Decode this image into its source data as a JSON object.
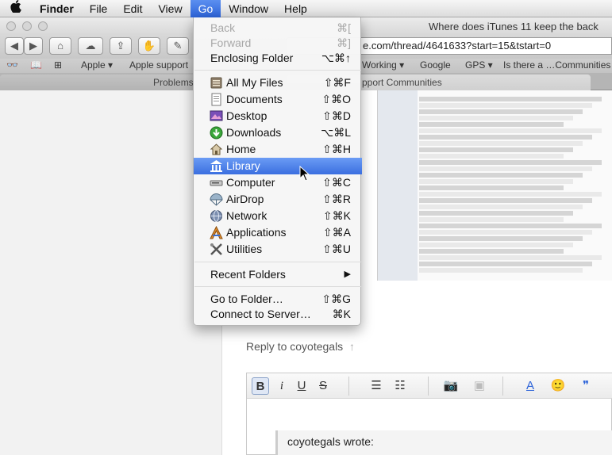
{
  "menubar": {
    "apple_icon": "apple-logo-icon",
    "items": [
      "Finder",
      "File",
      "Edit",
      "View",
      "Go",
      "Window",
      "Help"
    ]
  },
  "window": {
    "title": "Where does iTunes 11 keep the back"
  },
  "toolbar": {
    "url": "e.com/thread/4641633?start=15&tstart=0"
  },
  "bookmarks": [
    "Apple ▾",
    "Apple support",
    "Working ▾",
    "Google",
    "GPS ▾",
    "Is there a …Communities"
  ],
  "tabs": [
    "Problems",
    "pport Communities"
  ],
  "go_menu": {
    "items": [
      {
        "label": "Back",
        "shortcut": "⌘[",
        "disabled": true
      },
      {
        "label": "Forward",
        "shortcut": "⌘]",
        "disabled": true
      },
      {
        "label": "Enclosing Folder",
        "shortcut": "⌥⌘↑"
      },
      {
        "label": "All My Files",
        "shortcut": "⇧⌘F",
        "icon": "all-my-files-icon"
      },
      {
        "label": "Documents",
        "shortcut": "⇧⌘O",
        "icon": "documents-icon"
      },
      {
        "label": "Desktop",
        "shortcut": "⇧⌘D",
        "icon": "desktop-icon"
      },
      {
        "label": "Downloads",
        "shortcut": "⌥⌘L",
        "icon": "downloads-icon"
      },
      {
        "label": "Home",
        "shortcut": "⇧⌘H",
        "icon": "home-icon"
      },
      {
        "label": "Library",
        "shortcut": "",
        "icon": "library-icon",
        "highlighted": true
      },
      {
        "label": "Computer",
        "shortcut": "⇧⌘C",
        "icon": "computer-icon"
      },
      {
        "label": "AirDrop",
        "shortcut": "⇧⌘R",
        "icon": "airdrop-icon"
      },
      {
        "label": "Network",
        "shortcut": "⇧⌘K",
        "icon": "network-icon"
      },
      {
        "label": "Applications",
        "shortcut": "⇧⌘A",
        "icon": "applications-icon"
      },
      {
        "label": "Utilities",
        "shortcut": "⇧⌘U",
        "icon": "utilities-icon"
      },
      {
        "label": "Recent Folders",
        "shortcut": "▶"
      },
      {
        "label": "Go to Folder…",
        "shortcut": "⇧⌘G"
      },
      {
        "label": "Connect to Server…",
        "shortcut": "⌘K"
      }
    ]
  },
  "page": {
    "reply_link": "Reply to coyotegals",
    "quote_label": "coyotegals wrote:"
  },
  "colors": {
    "highlight": "#3b6fe0",
    "menu_bg": "#f6f6f6"
  }
}
